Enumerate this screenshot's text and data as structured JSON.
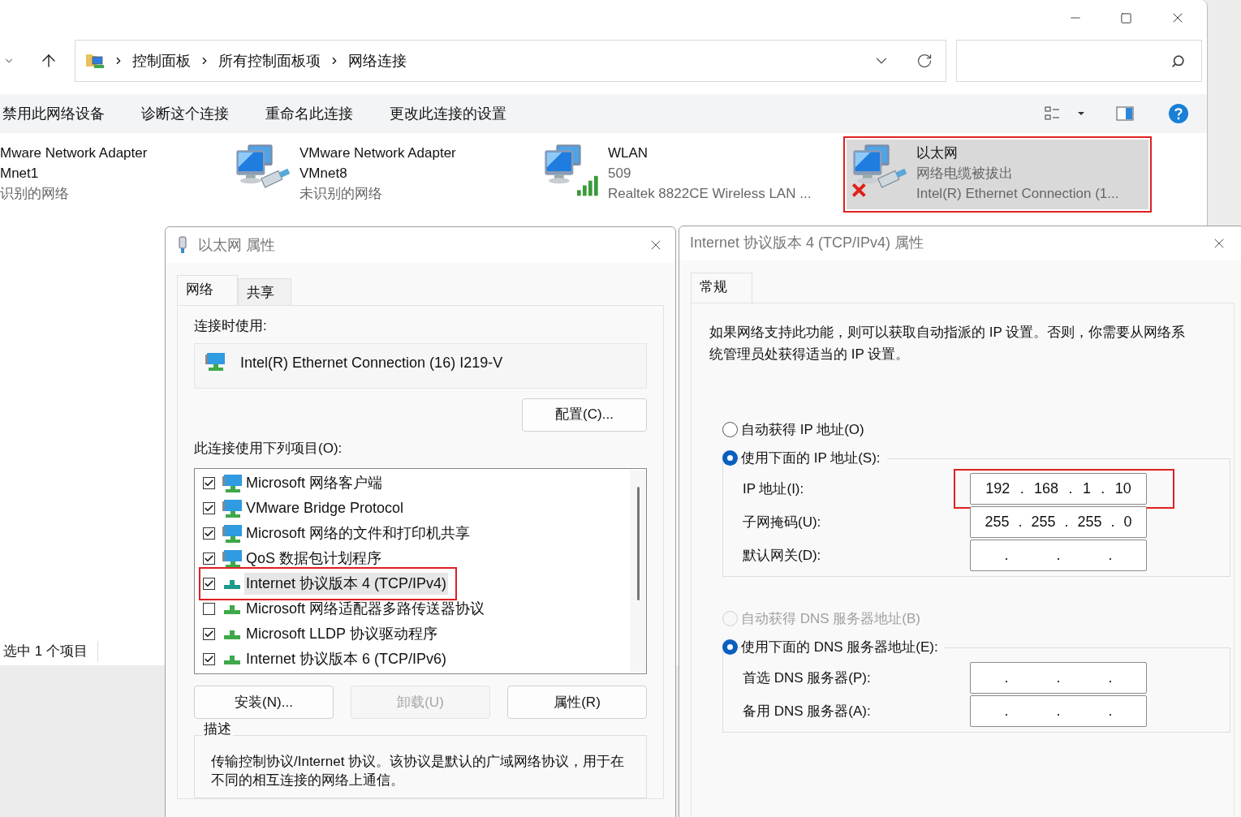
{
  "explorer": {
    "breadcrumbs": [
      "控制面板",
      "所有控制面板项",
      "网络连接"
    ],
    "commands": [
      "禁用此网络设备",
      "诊断这个连接",
      "重命名此连接",
      "更改此连接的设置"
    ],
    "adapters": [
      {
        "name_lines": [
          "Mware Network Adapter",
          "Mnet1"
        ],
        "detail_lines": [
          "识别的网络"
        ],
        "selected": false,
        "highlighted": false
      },
      {
        "kind": "cable",
        "name_lines": [
          "VMware Network Adapter",
          "VMnet8"
        ],
        "detail_lines": [
          "未识别的网络"
        ],
        "selected": false,
        "highlighted": false
      },
      {
        "kind": "wifi",
        "name_lines": [
          "WLAN"
        ],
        "detail_lines": [
          "509",
          "Realtek 8822CE Wireless LAN ..."
        ],
        "selected": false,
        "highlighted": false
      },
      {
        "kind": "unplugged",
        "name_lines": [
          "以太网"
        ],
        "detail_lines": [
          "网络电缆被拔出",
          "Intel(R) Ethernet Connection (1..."
        ],
        "selected": true,
        "highlighted": true
      }
    ],
    "status_bar": "选中 1 个项目"
  },
  "ethernet_dialog": {
    "title": "以太网 属性",
    "tabs": [
      {
        "label": "网络",
        "selected": true
      },
      {
        "label": "共享",
        "selected": false
      }
    ],
    "connect_label": "连接时使用:",
    "adapter_name": "Intel(R) Ethernet Connection (16) I219-V",
    "configure_button": "配置(C)...",
    "items_label": "此连接使用下列项目(O):",
    "items": [
      {
        "kind": "client",
        "label": "Microsoft 网络客户端",
        "checked": true,
        "selected": false,
        "highlighted": false
      },
      {
        "kind": "client",
        "label": "VMware Bridge Protocol",
        "checked": true,
        "selected": false,
        "highlighted": false
      },
      {
        "kind": "client",
        "label": "Microsoft 网络的文件和打印机共享",
        "checked": true,
        "selected": false,
        "highlighted": false
      },
      {
        "kind": "client",
        "label": "QoS 数据包计划程序",
        "checked": true,
        "selected": false,
        "highlighted": false
      },
      {
        "kind": "protocol_active",
        "label": "Internet 协议版本 4 (TCP/IPv4)",
        "checked": true,
        "selected": true,
        "highlighted": true
      },
      {
        "kind": "protocol",
        "label": "Microsoft 网络适配器多路传送器协议",
        "checked": false,
        "selected": false,
        "highlighted": false
      },
      {
        "kind": "protocol",
        "label": "Microsoft LLDP 协议驱动程序",
        "checked": true,
        "selected": false,
        "highlighted": false
      },
      {
        "kind": "protocol",
        "label": "Internet 协议版本 6 (TCP/IPv6)",
        "checked": true,
        "selected": false,
        "highlighted": false
      }
    ],
    "buttons": [
      {
        "label": "安装(N)...",
        "disabled": false
      },
      {
        "label": "卸载(U)",
        "disabled": true
      },
      {
        "label": "属性(R)",
        "disabled": false
      }
    ],
    "description": {
      "title": "描述",
      "text": "传输控制协议/Internet 协议。该协议是默认的广域网络协议，用于在不同的相互连接的网络上通信。"
    }
  },
  "ipv4_dialog": {
    "title": "Internet 协议版本 4 (TCP/IPv4) 属性",
    "tabs": [
      {
        "label": "常规",
        "selected": true
      }
    ],
    "intro": "如果网络支持此功能，则可以获取自动指派的 IP 设置。否则，你需要从网络系统管理员处获得适当的 IP 设置。",
    "ip_mode": [
      {
        "label": "自动获得 IP 地址(O)",
        "selected": false,
        "disabled": false
      },
      {
        "label": "使用下面的 IP 地址(S):",
        "selected": true,
        "disabled": false
      }
    ],
    "ip_fields": [
      {
        "label": "IP 地址(I):",
        "segments": [
          "192",
          ".",
          "168",
          ".",
          "1",
          ".",
          "10"
        ],
        "highlighted": true
      },
      {
        "label": "子网掩码(U):",
        "segments": [
          "255",
          ".",
          "255",
          ".",
          "255",
          ".",
          "0"
        ],
        "highlighted": false
      },
      {
        "label": "默认网关(D):",
        "segments": [
          ".",
          ".",
          "."
        ],
        "highlighted": false
      }
    ],
    "dns_mode": [
      {
        "label": "自动获得 DNS 服务器地址(B)",
        "selected": false,
        "disabled": true
      },
      {
        "label": "使用下面的 DNS 服务器地址(E):",
        "selected": true,
        "disabled": false
      }
    ],
    "dns_fields": [
      {
        "label": "首选 DNS 服务器(P):",
        "segments": [
          ".",
          ".",
          "."
        ],
        "highlighted": false
      },
      {
        "label": "备用 DNS 服务器(A):",
        "segments": [
          ".",
          ".",
          "."
        ],
        "highlighted": false
      }
    ]
  }
}
